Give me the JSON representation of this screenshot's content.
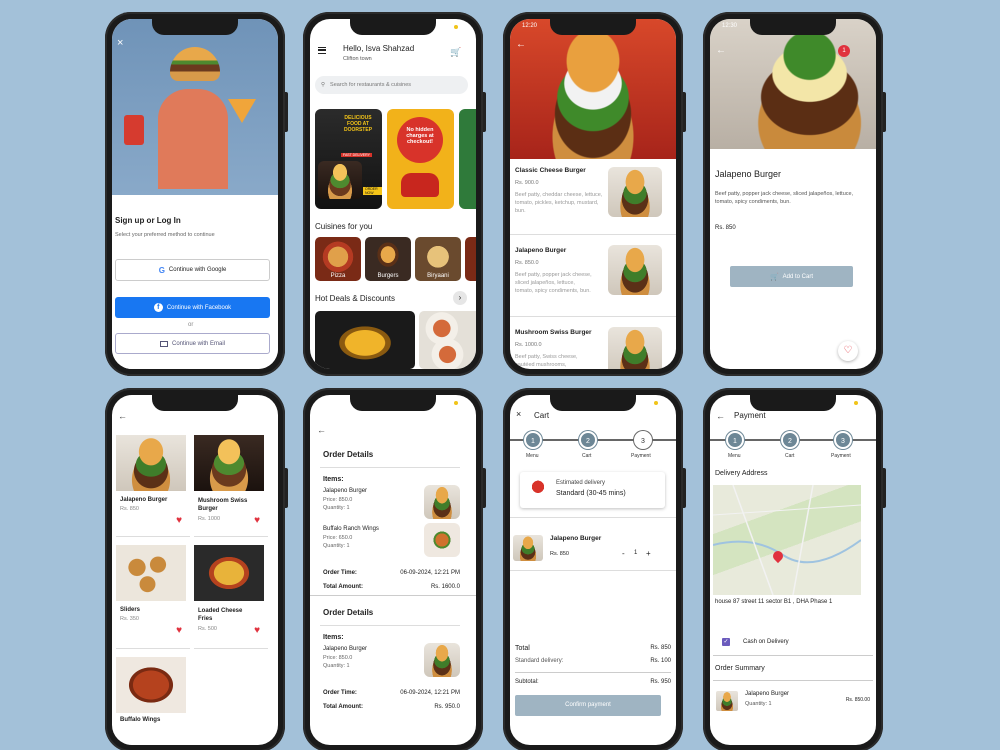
{
  "p1": {
    "close": "×",
    "title": "Sign up or Log In",
    "subtitle": "Select your preferred method to continue",
    "google": "Continue with Google",
    "facebook": "Continue with Facebook",
    "or": "or",
    "email": "Continue with Email"
  },
  "p2": {
    "greeting": "Hello, Isva Shahzad",
    "location": "Clifton town",
    "search_placeholder": "Search for restaurants & cuisines",
    "banner1": "DELICIOUS FOOD AT DOORSTEP",
    "banner1_tag": "FAST DELIVERY",
    "banner1_btn": "ORDER NOW",
    "banner2": "No hidden charges at checkout!",
    "cuisines_title": "Cuisines for you",
    "cuisines": [
      "Pizza",
      "Burgers",
      "Biryaani"
    ],
    "deals_title": "Hot Deals & Discounts"
  },
  "p3": {
    "time": "12:20",
    "items": [
      {
        "name": "Classic Cheese Burger",
        "price": "Rs. 900.0",
        "desc": "Beef patty, cheddar cheese, lettuce, tomato, pickles, ketchup, mustard, bun."
      },
      {
        "name": "Jalapeno Burger",
        "price": "Rs. 850.0",
        "desc": "Beef patty, popper jack cheese, sliced jalapeños, lettuce, tomato, spicy condiments, bun."
      },
      {
        "name": "Mushroom Swiss Burger",
        "price": "Rs. 1000.0",
        "desc": "Beef patty, Swiss cheese, sautéed mushrooms,"
      }
    ]
  },
  "p4": {
    "time": "12:30",
    "badge": "1",
    "title": "Jalapeno Burger",
    "desc": "Beef patty, popper jack cheese, sliced jalapeños, lettuce, tomato, spicy condiments, bun.",
    "price": "Rs. 850",
    "add": "Add to Cart"
  },
  "p5": {
    "items": [
      {
        "name": "Jalapeno Burger",
        "price": "Rs. 850"
      },
      {
        "name": "Mushroom Swiss Burger",
        "price": "Rs. 1000"
      },
      {
        "name": "Sliders",
        "price": "Rs. 350"
      },
      {
        "name": "Loaded Cheese Fries",
        "price": "Rs. 500"
      },
      {
        "name": "Buffalo Wings",
        "price": ""
      }
    ]
  },
  "p6": {
    "orders": [
      {
        "title": "Order Details",
        "items_label": "Items:",
        "items": [
          {
            "name": "Jalapeno Burger",
            "price": "Price: 850.0",
            "qty": "Quantity: 1"
          },
          {
            "name": "Buffalo Ranch Wings",
            "price": "Price: 650.0",
            "qty": "Quantity: 1"
          }
        ],
        "time_label": "Order Time:",
        "time": "06-09-2024, 12:21 PM",
        "total_label": "Total Amount:",
        "total": "Rs. 1600.0"
      },
      {
        "title": "Order Details",
        "items_label": "Items:",
        "items": [
          {
            "name": "Jalapeno Burger",
            "price": "Price: 850.0",
            "qty": "Quantity: 1"
          }
        ],
        "time_label": "Order Time:",
        "time": "06-09-2024, 12:21 PM",
        "total_label": "Total Amount:",
        "total": "Rs. 950.0"
      }
    ]
  },
  "p7": {
    "title": "Cart",
    "steps": [
      "Menu",
      "Cart",
      "Payment"
    ],
    "est_label": "Estimated delivery",
    "est_value": "Standard (30-45 mins)",
    "item_name": "Jalapeno Burger",
    "item_price": "Rs. 850",
    "qty": "1",
    "total_label": "Total",
    "total": "Rs. 850",
    "delivery_label": "Standard delivery:",
    "delivery": "Rs. 100",
    "subtotal_label": "Subtotal:",
    "subtotal": "Rs. 950",
    "confirm": "Confirm payment"
  },
  "p8": {
    "title": "Payment",
    "steps": [
      "Menu",
      "Cart",
      "Payment"
    ],
    "addr_title": "Delivery Address",
    "address": "house 87 street 11 sector B1 , DHA Phase 1",
    "cod": "Cash on Delivery",
    "summary_title": "Order Summary",
    "item_name": "Jalapeno Burger",
    "item_qty": "Quantity: 1",
    "item_price": "Rs. 850.00"
  },
  "colors": {
    "bg": "#a3c1d9",
    "facebook": "#1877f2",
    "accent_red": "#e0323e",
    "slate": "#6d8796",
    "button_gray": "#9fb4c2"
  }
}
